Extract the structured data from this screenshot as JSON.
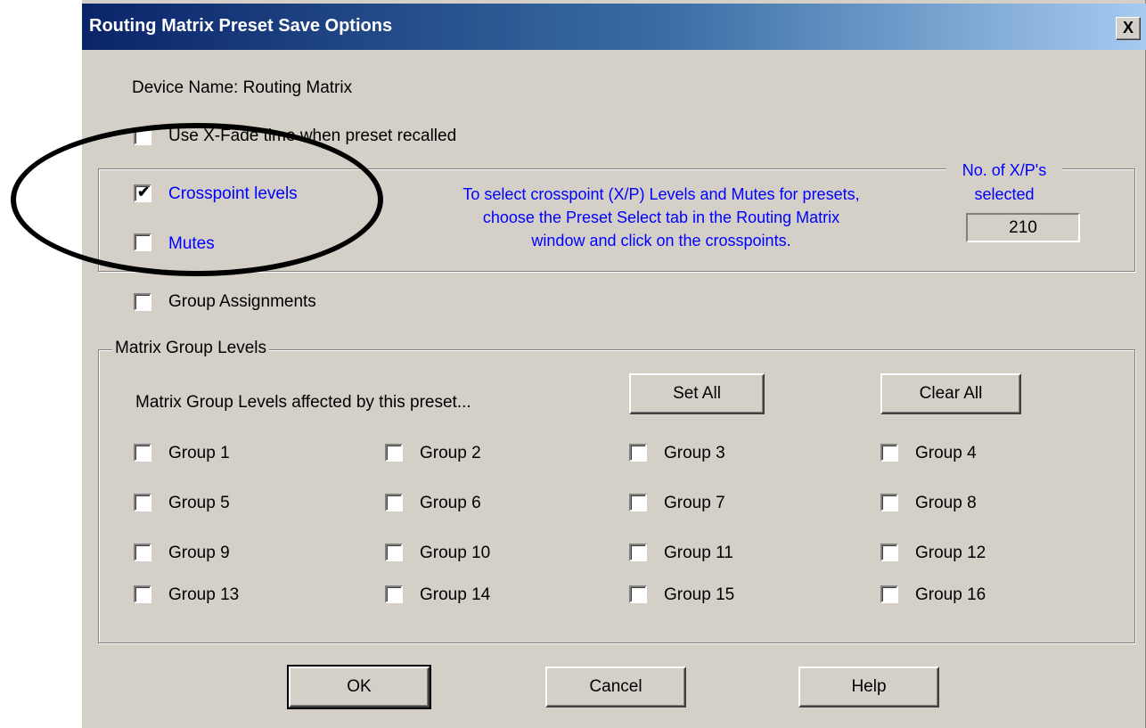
{
  "window": {
    "title": "Routing Matrix Preset Save Options",
    "close_glyph": "X"
  },
  "device_name": "Device Name: Routing Matrix",
  "xfade": {
    "label": "Use X-Fade time when preset recalled",
    "checked": false
  },
  "crosspoints": {
    "levels": {
      "label": "Crosspoint levels",
      "checked": true
    },
    "mutes": {
      "label": "Mutes",
      "checked": false
    },
    "info_lines": [
      "To select crosspoint (X/P) Levels and Mutes for presets,",
      "choose the Preset Select tab in the Routing Matrix",
      "window and click on the crosspoints."
    ],
    "count_label_line1": "No. of X/P's",
    "count_label_line2": "selected",
    "count_value": "210"
  },
  "group_assignments": {
    "label": "Group Assignments",
    "checked": false
  },
  "matrix_group_levels": {
    "legend": "Matrix Group Levels",
    "description": "Matrix Group Levels affected by this preset...",
    "set_all_label": "Set All",
    "clear_all_label": "Clear All",
    "groups": [
      "Group 1",
      "Group 2",
      "Group 3",
      "Group 4",
      "Group 5",
      "Group 6",
      "Group 7",
      "Group 8",
      "Group 9",
      "Group 10",
      "Group 11",
      "Group 12",
      "Group 13",
      "Group 14",
      "Group 15",
      "Group 16"
    ]
  },
  "buttons": {
    "ok": "OK",
    "cancel": "Cancel",
    "help": "Help"
  },
  "colors": {
    "accent_text": "#0000ff",
    "annotation": "#000000",
    "dialog_bg": "#d4d0c8"
  }
}
